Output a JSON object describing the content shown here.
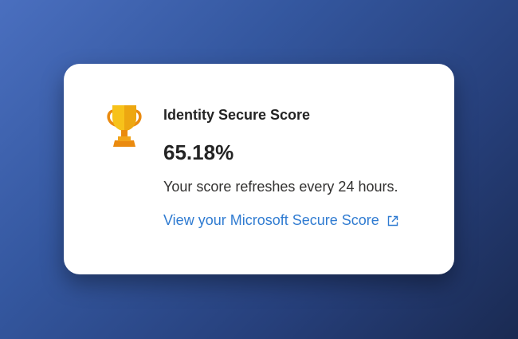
{
  "card": {
    "icon": "trophy-icon",
    "title": "Identity Secure Score",
    "score": "65.18%",
    "description": "Your score refreshes every 24 hours.",
    "link_label": "View your Microsoft Secure Score",
    "link_icon": "external-link-icon"
  },
  "colors": {
    "link": "#2f7bd1",
    "trophy_gold": "#f7c21a",
    "trophy_orange": "#ea8a0f",
    "text": "#242424"
  }
}
